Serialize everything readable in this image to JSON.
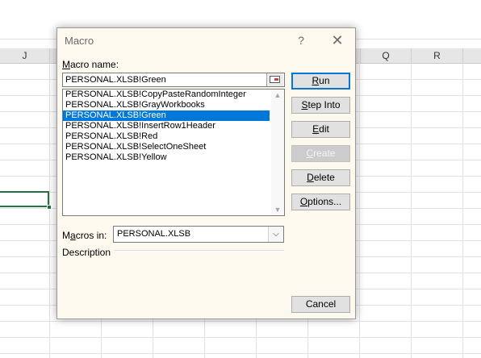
{
  "sheet": {
    "columns": [
      "J",
      "Q",
      "R"
    ]
  },
  "dialog": {
    "title": "Macro",
    "help_label": "?",
    "close_label": "✕",
    "macro_name_label_hotkey": "M",
    "macro_name_label_rest": "acro name:",
    "macro_name_value": "PERSONAL.XLSB!Green",
    "macro_list": [
      "PERSONAL.XLSB!CopyPasteRandomInteger",
      "PERSONAL.XLSB!GrayWorkbooks",
      "PERSONAL.XLSB!Green",
      "PERSONAL.XLSB!InsertRow1Header",
      "PERSONAL.XLSB!Red",
      "PERSONAL.XLSB!SelectOneSheet",
      "PERSONAL.XLSB!Yellow"
    ],
    "selected_index": 2,
    "macros_in_label_pre": "M",
    "macros_in_label_hotkey": "a",
    "macros_in_label_rest": "cros in:",
    "macros_in_value": "PERSONAL.XLSB",
    "description_label": "Description",
    "buttons": {
      "run": {
        "hotkey": "R",
        "rest": "un"
      },
      "step_into": {
        "hotkey": "S",
        "rest": "tep Into"
      },
      "edit": {
        "hotkey": "E",
        "rest": "dit"
      },
      "create": {
        "hotkey": "C",
        "rest": "reate"
      },
      "delete": {
        "hotkey": "D",
        "rest": "elete"
      },
      "options": {
        "hotkey": "O",
        "rest": "ptions..."
      },
      "cancel": "Cancel"
    },
    "scroll_up_icon": "▲",
    "scroll_down_icon": "▼",
    "dropdown_icon": "⌵"
  },
  "colors": {
    "accent": "#0078d7",
    "selected_cell": "#217346",
    "dialog_bg": "#fdf9ee"
  }
}
